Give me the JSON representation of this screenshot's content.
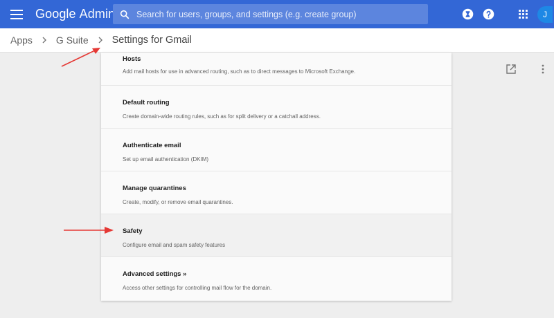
{
  "header": {
    "logo_google": "Google",
    "logo_admin": "Admin",
    "search_placeholder": "Search for users, groups, and settings (e.g. create group)",
    "avatar_initial": "J"
  },
  "breadcrumb": {
    "items": [
      "Apps",
      "G Suite"
    ],
    "current": "Settings for Gmail"
  },
  "settings": [
    {
      "title": "Hosts",
      "desc": "Add mail hosts for use in advanced routing, such as to direct messages to Microsoft Exchange."
    },
    {
      "title": "Default routing",
      "desc": "Create domain-wide routing rules, such as for split delivery or a catchall address."
    },
    {
      "title": "Authenticate email",
      "desc": "Set up email authentication (DKIM)"
    },
    {
      "title": "Manage quarantines",
      "desc": "Create, modify, or remove email quarantines."
    },
    {
      "title": "Safety",
      "desc": "Configure email and spam safety features"
    },
    {
      "title": "Advanced settings »",
      "desc": "Access other settings for controlling mail flow for the domain."
    }
  ],
  "colors": {
    "header_blue": "#3367d6",
    "search_blue": "#5c85de",
    "annotation_red": "#e53935"
  }
}
